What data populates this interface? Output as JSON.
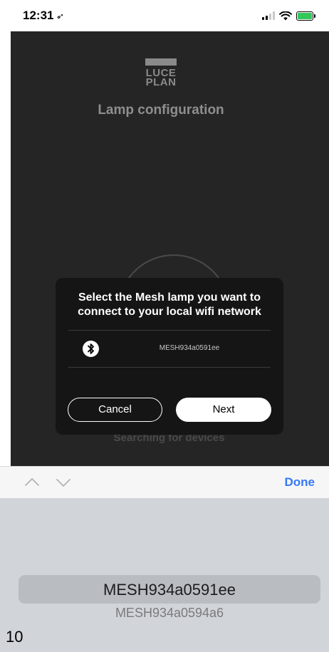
{
  "status_bar": {
    "time": "12:31",
    "location_icon": "location-arrow-icon",
    "signal_icon": "cellular-signal-icon",
    "wifi_icon": "wifi-icon",
    "battery_icon": "battery-charging-icon"
  },
  "app": {
    "logo_line1": "LUCE",
    "logo_line2": "PLAN",
    "title": "Lamp configuration",
    "searching_text": "Searching for devices",
    "background_color": "#252526"
  },
  "modal": {
    "message": "Select the Mesh lamp you want to connect to your local wifi network",
    "device": {
      "icon": "bluetooth-icon",
      "name": "MESH934a0591ee"
    },
    "cancel_label": "Cancel",
    "next_label": "Next"
  },
  "picker_toolbar": {
    "up_icon": "chevron-up-icon",
    "down_icon": "chevron-down-icon",
    "done_label": "Done",
    "done_color": "#3478f6"
  },
  "picker": {
    "selected": "MESH934a0591ee",
    "options": [
      "MESH934a0594a6"
    ],
    "overlay_text": "10"
  }
}
